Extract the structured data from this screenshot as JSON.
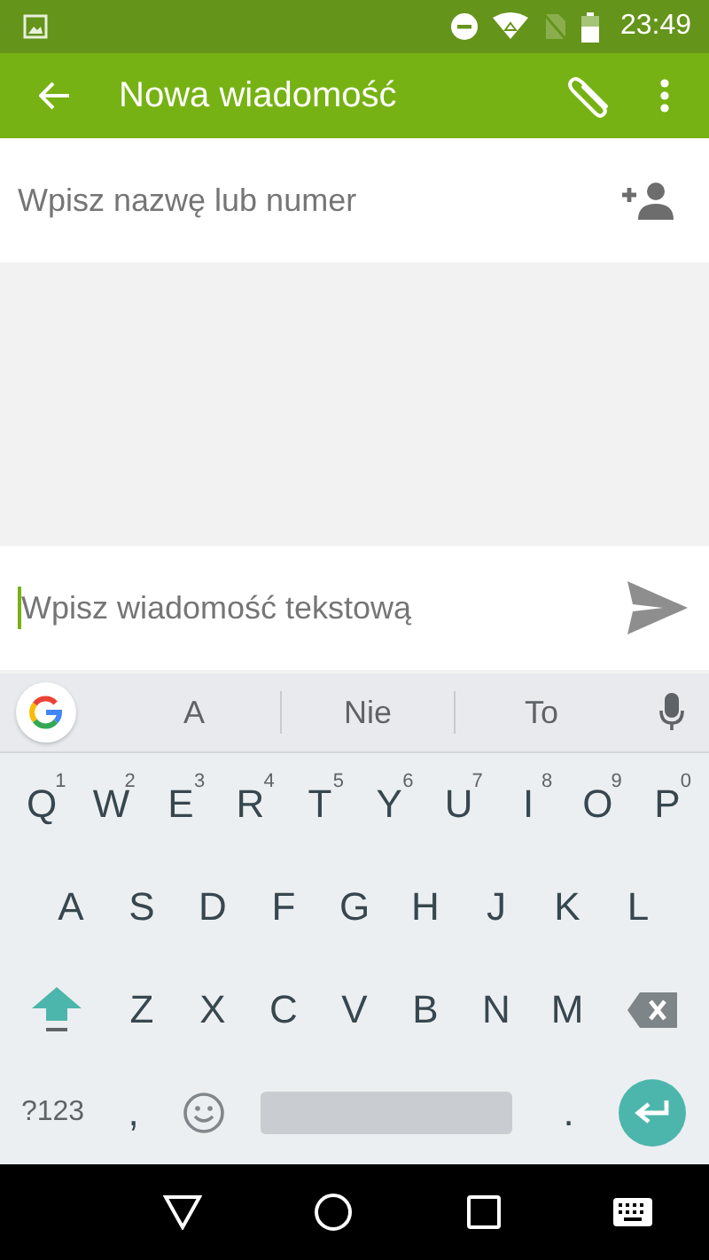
{
  "status_bar": {
    "time": "23:49"
  },
  "app_bar": {
    "title": "Nowa wiadomość"
  },
  "recipient": {
    "placeholder": "Wpisz nazwę lub numer"
  },
  "compose": {
    "placeholder": "Wpisz wiadomość tekstową"
  },
  "keyboard": {
    "suggestions": [
      "A",
      "Nie",
      "To"
    ],
    "shift_on": true,
    "letter_rows": [
      [
        {
          "kind": "letter",
          "label": "Q",
          "hint": "1"
        },
        {
          "kind": "letter",
          "label": "W",
          "hint": "2"
        },
        {
          "kind": "letter",
          "label": "E",
          "hint": "3"
        },
        {
          "kind": "letter",
          "label": "R",
          "hint": "4"
        },
        {
          "kind": "letter",
          "label": "T",
          "hint": "5"
        },
        {
          "kind": "letter",
          "label": "Y",
          "hint": "6"
        },
        {
          "kind": "letter",
          "label": "U",
          "hint": "7"
        },
        {
          "kind": "letter",
          "label": "I",
          "hint": "8"
        },
        {
          "kind": "letter",
          "label": "O",
          "hint": "9"
        },
        {
          "kind": "letter",
          "label": "P",
          "hint": "0"
        }
      ],
      [
        {
          "kind": "letter",
          "label": "A"
        },
        {
          "kind": "letter",
          "label": "S"
        },
        {
          "kind": "letter",
          "label": "D"
        },
        {
          "kind": "letter",
          "label": "F"
        },
        {
          "kind": "letter",
          "label": "G"
        },
        {
          "kind": "letter",
          "label": "H"
        },
        {
          "kind": "letter",
          "label": "J"
        },
        {
          "kind": "letter",
          "label": "K"
        },
        {
          "kind": "letter",
          "label": "L"
        }
      ],
      [
        {
          "kind": "shift"
        },
        {
          "kind": "letter",
          "label": "Z"
        },
        {
          "kind": "letter",
          "label": "X"
        },
        {
          "kind": "letter",
          "label": "C"
        },
        {
          "kind": "letter",
          "label": "V"
        },
        {
          "kind": "letter",
          "label": "B"
        },
        {
          "kind": "letter",
          "label": "N"
        },
        {
          "kind": "letter",
          "label": "M"
        },
        {
          "kind": "backspace"
        }
      ]
    ],
    "bottom_row": [
      {
        "kind": "symbols",
        "label": "?123"
      },
      {
        "kind": "letter",
        "label": ","
      },
      {
        "kind": "emoji"
      },
      {
        "kind": "space"
      },
      {
        "kind": "letter",
        "label": "."
      },
      {
        "kind": "enter"
      }
    ]
  }
}
